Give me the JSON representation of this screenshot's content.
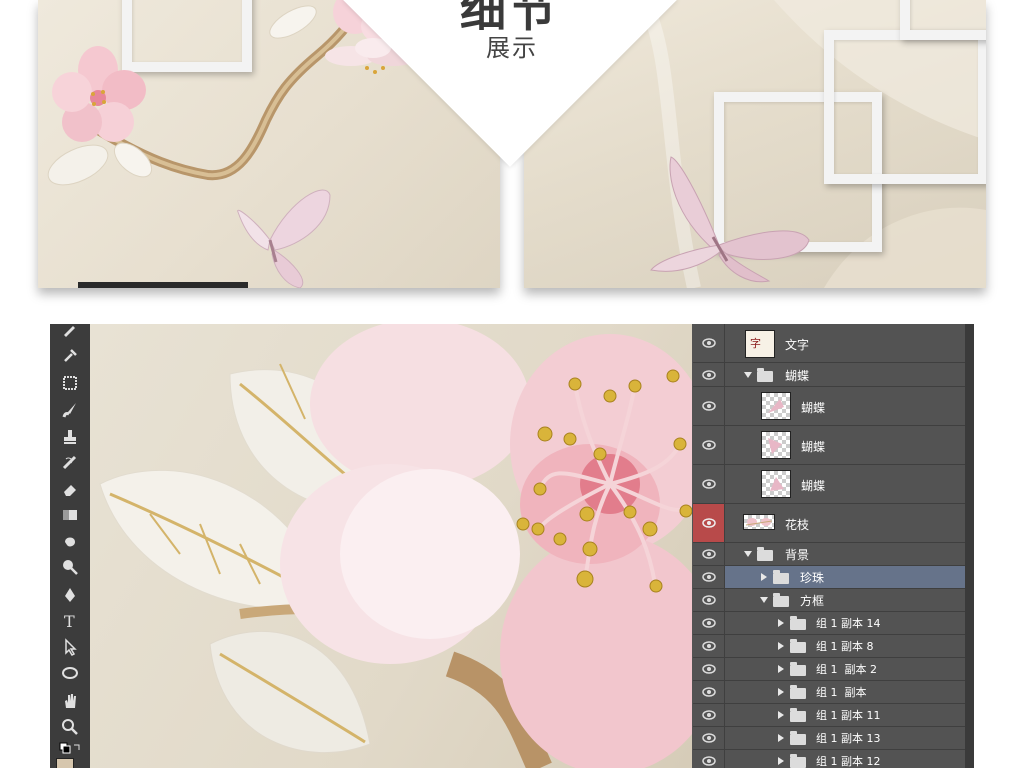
{
  "preview": {
    "title": "细节",
    "subtitle": "展示"
  },
  "toolbar": {
    "tools": [
      "brush-icon",
      "eyedropper-icon",
      "healing-icon",
      "paintbrush-icon",
      "stamp-icon",
      "history-brush-icon",
      "eraser-icon",
      "gradient-icon",
      "blur-icon",
      "dodge-icon",
      "pen-icon",
      "type-icon",
      "path-select-icon",
      "shape-icon",
      "hand-icon",
      "zoom-icon",
      "swap-colors-icon"
    ]
  },
  "layers": [
    {
      "name": "文字",
      "type": "layer",
      "thumb": "text"
    },
    {
      "name": "蝴蝶",
      "type": "group",
      "expanded": true
    },
    {
      "name": "蝴蝶",
      "type": "layer",
      "thumb": "butterfly"
    },
    {
      "name": "蝴蝶",
      "type": "layer",
      "thumb": "butterfly"
    },
    {
      "name": "蝴蝶",
      "type": "layer",
      "thumb": "butterfly"
    },
    {
      "name": "花枝",
      "type": "layer",
      "thumb": "branch",
      "eye_highlight": true
    },
    {
      "name": "背景",
      "type": "group",
      "expanded": true
    },
    {
      "name": "珍珠",
      "type": "group",
      "expanded": false,
      "selected": true
    },
    {
      "name": "方框",
      "type": "group",
      "expanded": true
    },
    {
      "name": "组 1 副本 14",
      "type": "group",
      "expanded": false
    },
    {
      "name": "组 1 副本 8",
      "type": "group",
      "expanded": false
    },
    {
      "name": "组 1  副本 2",
      "type": "group",
      "expanded": false
    },
    {
      "name": "组 1  副本",
      "type": "group",
      "expanded": false
    },
    {
      "name": "组 1 副本 11",
      "type": "group",
      "expanded": false
    },
    {
      "name": "组 1 副本 13",
      "type": "group",
      "expanded": false
    },
    {
      "name": "组 1 副本 12",
      "type": "group",
      "expanded": false
    }
  ],
  "colors": {
    "panel_bg": "#535353",
    "selected_row": "#66738a",
    "eye_highlight": "#b84a4a",
    "flower_pink": "#f3c9cf"
  }
}
